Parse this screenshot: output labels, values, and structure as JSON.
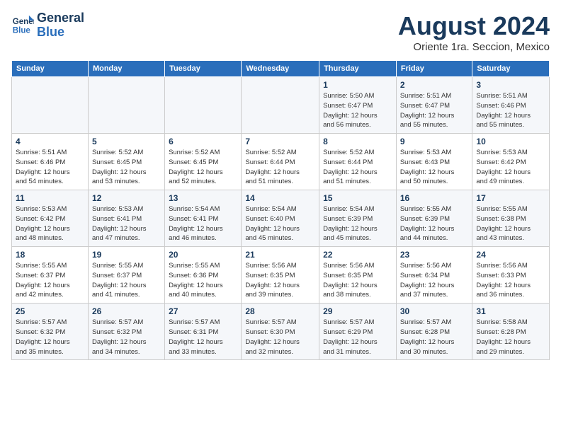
{
  "logo": {
    "line1": "General",
    "line2": "Blue"
  },
  "title": "August 2024",
  "subtitle": "Oriente 1ra. Seccion, Mexico",
  "days_of_week": [
    "Sunday",
    "Monday",
    "Tuesday",
    "Wednesday",
    "Thursday",
    "Friday",
    "Saturday"
  ],
  "weeks": [
    [
      {
        "day": "",
        "detail": ""
      },
      {
        "day": "",
        "detail": ""
      },
      {
        "day": "",
        "detail": ""
      },
      {
        "day": "",
        "detail": ""
      },
      {
        "day": "1",
        "detail": "Sunrise: 5:50 AM\nSunset: 6:47 PM\nDaylight: 12 hours\nand 56 minutes."
      },
      {
        "day": "2",
        "detail": "Sunrise: 5:51 AM\nSunset: 6:47 PM\nDaylight: 12 hours\nand 55 minutes."
      },
      {
        "day": "3",
        "detail": "Sunrise: 5:51 AM\nSunset: 6:46 PM\nDaylight: 12 hours\nand 55 minutes."
      }
    ],
    [
      {
        "day": "4",
        "detail": "Sunrise: 5:51 AM\nSunset: 6:46 PM\nDaylight: 12 hours\nand 54 minutes."
      },
      {
        "day": "5",
        "detail": "Sunrise: 5:52 AM\nSunset: 6:45 PM\nDaylight: 12 hours\nand 53 minutes."
      },
      {
        "day": "6",
        "detail": "Sunrise: 5:52 AM\nSunset: 6:45 PM\nDaylight: 12 hours\nand 52 minutes."
      },
      {
        "day": "7",
        "detail": "Sunrise: 5:52 AM\nSunset: 6:44 PM\nDaylight: 12 hours\nand 51 minutes."
      },
      {
        "day": "8",
        "detail": "Sunrise: 5:52 AM\nSunset: 6:44 PM\nDaylight: 12 hours\nand 51 minutes."
      },
      {
        "day": "9",
        "detail": "Sunrise: 5:53 AM\nSunset: 6:43 PM\nDaylight: 12 hours\nand 50 minutes."
      },
      {
        "day": "10",
        "detail": "Sunrise: 5:53 AM\nSunset: 6:42 PM\nDaylight: 12 hours\nand 49 minutes."
      }
    ],
    [
      {
        "day": "11",
        "detail": "Sunrise: 5:53 AM\nSunset: 6:42 PM\nDaylight: 12 hours\nand 48 minutes."
      },
      {
        "day": "12",
        "detail": "Sunrise: 5:53 AM\nSunset: 6:41 PM\nDaylight: 12 hours\nand 47 minutes."
      },
      {
        "day": "13",
        "detail": "Sunrise: 5:54 AM\nSunset: 6:41 PM\nDaylight: 12 hours\nand 46 minutes."
      },
      {
        "day": "14",
        "detail": "Sunrise: 5:54 AM\nSunset: 6:40 PM\nDaylight: 12 hours\nand 45 minutes."
      },
      {
        "day": "15",
        "detail": "Sunrise: 5:54 AM\nSunset: 6:39 PM\nDaylight: 12 hours\nand 45 minutes."
      },
      {
        "day": "16",
        "detail": "Sunrise: 5:55 AM\nSunset: 6:39 PM\nDaylight: 12 hours\nand 44 minutes."
      },
      {
        "day": "17",
        "detail": "Sunrise: 5:55 AM\nSunset: 6:38 PM\nDaylight: 12 hours\nand 43 minutes."
      }
    ],
    [
      {
        "day": "18",
        "detail": "Sunrise: 5:55 AM\nSunset: 6:37 PM\nDaylight: 12 hours\nand 42 minutes."
      },
      {
        "day": "19",
        "detail": "Sunrise: 5:55 AM\nSunset: 6:37 PM\nDaylight: 12 hours\nand 41 minutes."
      },
      {
        "day": "20",
        "detail": "Sunrise: 5:55 AM\nSunset: 6:36 PM\nDaylight: 12 hours\nand 40 minutes."
      },
      {
        "day": "21",
        "detail": "Sunrise: 5:56 AM\nSunset: 6:35 PM\nDaylight: 12 hours\nand 39 minutes."
      },
      {
        "day": "22",
        "detail": "Sunrise: 5:56 AM\nSunset: 6:35 PM\nDaylight: 12 hours\nand 38 minutes."
      },
      {
        "day": "23",
        "detail": "Sunrise: 5:56 AM\nSunset: 6:34 PM\nDaylight: 12 hours\nand 37 minutes."
      },
      {
        "day": "24",
        "detail": "Sunrise: 5:56 AM\nSunset: 6:33 PM\nDaylight: 12 hours\nand 36 minutes."
      }
    ],
    [
      {
        "day": "25",
        "detail": "Sunrise: 5:57 AM\nSunset: 6:32 PM\nDaylight: 12 hours\nand 35 minutes."
      },
      {
        "day": "26",
        "detail": "Sunrise: 5:57 AM\nSunset: 6:32 PM\nDaylight: 12 hours\nand 34 minutes."
      },
      {
        "day": "27",
        "detail": "Sunrise: 5:57 AM\nSunset: 6:31 PM\nDaylight: 12 hours\nand 33 minutes."
      },
      {
        "day": "28",
        "detail": "Sunrise: 5:57 AM\nSunset: 6:30 PM\nDaylight: 12 hours\nand 32 minutes."
      },
      {
        "day": "29",
        "detail": "Sunrise: 5:57 AM\nSunset: 6:29 PM\nDaylight: 12 hours\nand 31 minutes."
      },
      {
        "day": "30",
        "detail": "Sunrise: 5:57 AM\nSunset: 6:28 PM\nDaylight: 12 hours\nand 30 minutes."
      },
      {
        "day": "31",
        "detail": "Sunrise: 5:58 AM\nSunset: 6:28 PM\nDaylight: 12 hours\nand 29 minutes."
      }
    ]
  ]
}
